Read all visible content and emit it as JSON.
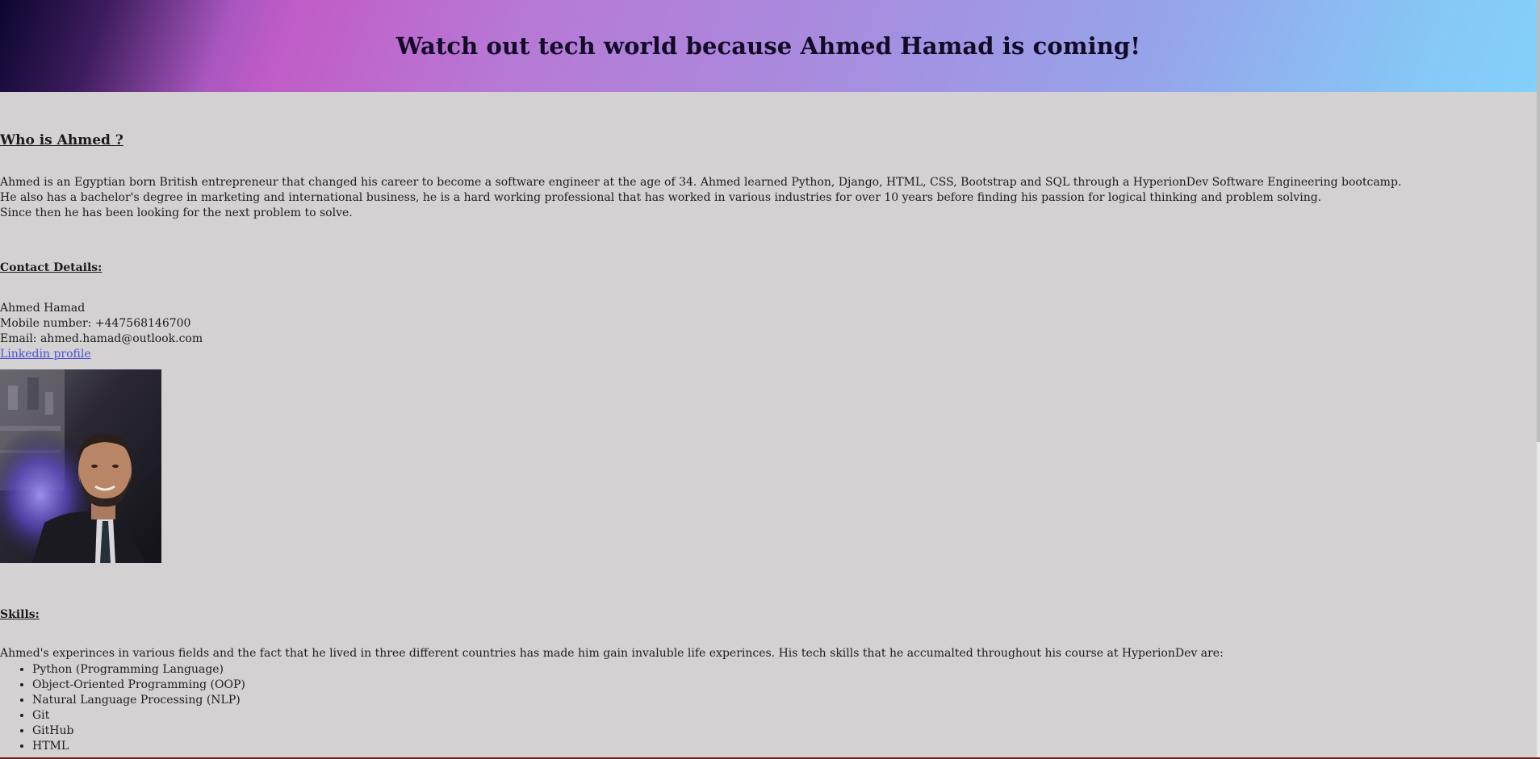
{
  "header": {
    "title": "Watch out tech world because Ahmed Hamad is coming!"
  },
  "about": {
    "heading": "Who is Ahmed ?",
    "lines": [
      "Ahmed is an Egyptian born British entrepreneur that changed his career to become a software engineer at the age of 34. Ahmed learned Python, Django, HTML, CSS, Bootstrap and SQL through a HyperionDev Software Engineering bootcamp.",
      "He also has a bachelor's degree in marketing and international business, he is a hard working professional that has worked in various industries for over 10 years before finding his passion for logical thinking and problem solving.",
      "Since then he has been looking for the next problem to solve."
    ]
  },
  "contact": {
    "heading": "Contact Details:",
    "name": "Ahmed Hamad",
    "mobile": "Mobile number: +447568146700",
    "email": "Email: ahmed.hamad@outlook.com",
    "linkedin_label": "Linkedin profile"
  },
  "photo": {
    "alt": "Ahmed Hamad"
  },
  "skills": {
    "heading": "Skills:",
    "intro": "Ahmed's experinces in various fields and the fact that he lived in three different countries has made him gain invaluble life experinces. His tech skills that he accumalted throughout his course at HyperionDev are:",
    "items": [
      "Python (Programming Language)",
      "Object-Oriented Programming (OOP)",
      "Natural Language Processing (NLP)",
      "Git",
      "GitHub",
      "HTML"
    ]
  },
  "colors": {
    "background": "#d3d1d2",
    "link": "#4b50d6",
    "gradient_start": "#0c0630",
    "gradient_mid": "#c05cc7",
    "gradient_end": "#82d0fc"
  }
}
